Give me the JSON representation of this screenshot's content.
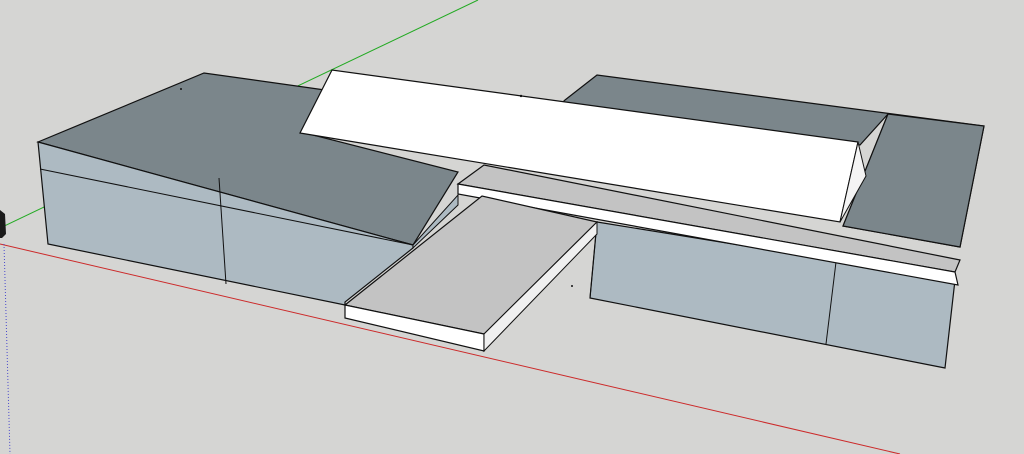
{
  "viewport": {
    "background": "#d5d5d3",
    "face_colors": {
      "top_dark": "#7b868b",
      "side_light": "#adbac2",
      "slab_top": "#c3c3c3",
      "slab_edge": "#ffffff",
      "roof": "#ffffff",
      "edge": "#111111"
    },
    "axis_colors": {
      "red_axis": "#cc2a2a",
      "green_axis": "#22aa22",
      "blue_axis": "#4a4acc"
    },
    "icons": [
      "person-figure-icon"
    ]
  }
}
